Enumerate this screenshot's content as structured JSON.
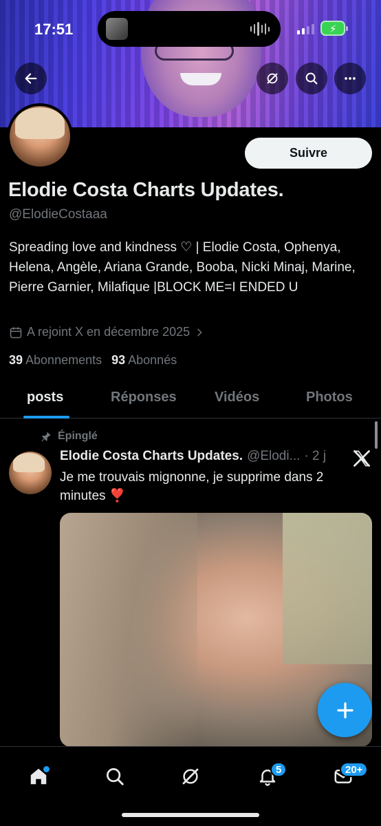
{
  "status_bar": {
    "time": "17:51"
  },
  "profile": {
    "follow_label": "Suivre",
    "display_name": "Elodie Costa Charts Updates.",
    "handle": "@ElodieCostaaa",
    "bio": "Spreading love and kindness ♡ | Elodie Costa, Ophenya, Helena, Angèle, Ariana Grande, Booba, Nicki Minaj, Marine, Pierre Garnier, Milafique |BLOCK ME=I ENDED U",
    "joined": "A rejoint X en décembre 2025",
    "following_count": "39",
    "following_label": "Abonnements",
    "followers_count": "93",
    "followers_label": "Abonnés"
  },
  "tabs": [
    "posts",
    "Réponses",
    "Vidéos",
    "Photos"
  ],
  "active_tab": "posts",
  "post": {
    "pinned_label": "Épinglé",
    "author_name": "Elodie Costa Charts Updates.",
    "author_handle": "@Elodi...",
    "age": "· 2 j",
    "text": "Je me trouvais mignonne, je supprime dans 2 minutes ❣️"
  },
  "nav": {
    "notifications_badge": "5",
    "messages_badge": "20+"
  },
  "colors": {
    "accent": "#1d9bf0",
    "background": "#000000",
    "secondary_text": "#71767b"
  },
  "icons": [
    "back-arrow-icon",
    "grok-icon",
    "search-icon",
    "more-icon",
    "calendar-icon",
    "chevron-right-icon",
    "pin-icon",
    "x-logo-icon",
    "plus-icon",
    "home-icon",
    "notifications-icon",
    "messages-icon"
  ]
}
